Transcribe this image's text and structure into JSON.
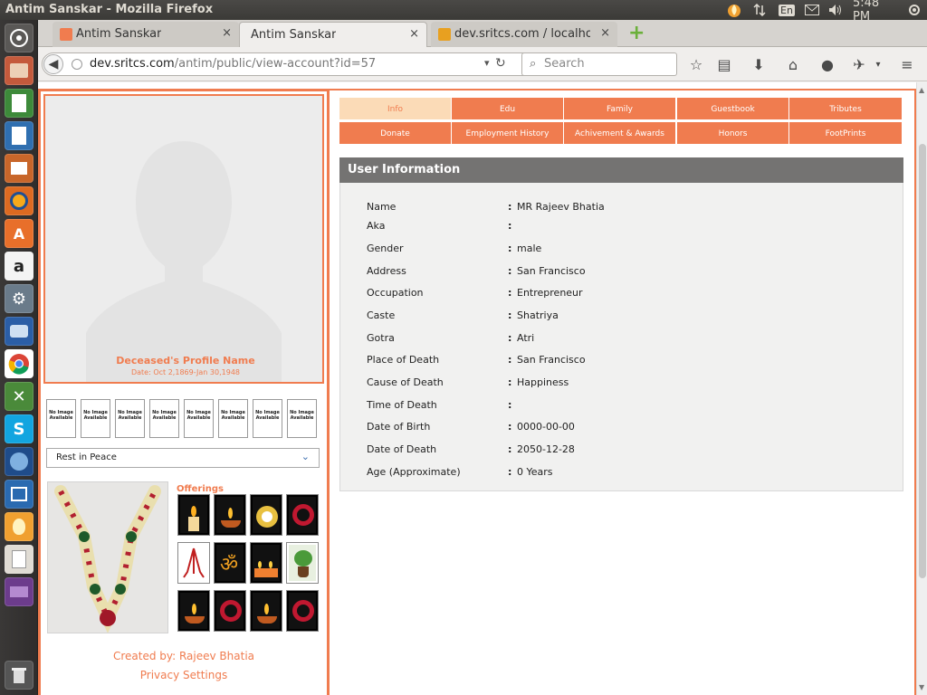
{
  "system": {
    "window_title": "Antim Sanskar - Mozilla Firefox",
    "keyboard_layout": "En",
    "clock": "5:48 PM"
  },
  "browser": {
    "tabs": [
      {
        "label": "Antim Sanskar",
        "close": "×",
        "active": false
      },
      {
        "label": "Antim Sanskar",
        "close": "×",
        "active": true
      },
      {
        "label": "dev.sritcs.com / localho…",
        "close": "×",
        "active": false
      }
    ],
    "new_tab": "+",
    "url_domain": "dev.sritcs.com",
    "url_path": "/antim/public/view-account?id=57",
    "search_placeholder": "Search"
  },
  "profile": {
    "name": "Deceased's Profile Name",
    "dates": "Date: Oct 2,1869-Jan 30,1948",
    "thumb_text": "No Image Available",
    "dropdown_value": "Rest in Peace",
    "offerings_title": "Offerings",
    "created_by": "Created by: Rajeev Bhatia",
    "privacy": "Privacy Settings"
  },
  "tabs_row1": [
    "Info",
    "Edu",
    "Family",
    "Guestbook",
    "Tributes"
  ],
  "tabs_row2": [
    "Donate",
    "Employment History",
    "Achivement & Awards",
    "Honors",
    "FootPrints"
  ],
  "info": {
    "title": "User Information",
    "rows": [
      {
        "label": "Name",
        "value": "MR Rajeev Bhatia"
      },
      {
        "label": "Aka",
        "value": ""
      },
      {
        "label": "Gender",
        "value": "male"
      },
      {
        "label": "Address",
        "value": "San Francisco"
      },
      {
        "label": "Occupation",
        "value": "Entrepreneur"
      },
      {
        "label": "Caste",
        "value": "Shatriya"
      },
      {
        "label": "Gotra",
        "value": "Atri"
      },
      {
        "label": "Place of Death",
        "value": "San Francisco"
      },
      {
        "label": "Cause of Death",
        "value": "Happiness"
      },
      {
        "label": "Time of Death",
        "value": ""
      },
      {
        "label": "Date of Birth",
        "value": "0000-00-00"
      },
      {
        "label": "Date of Death",
        "value": "2050-12-28"
      },
      {
        "label": "Age (Approximate)",
        "value": "0 Years"
      }
    ]
  },
  "colors": {
    "accent": "#f07c4f",
    "active_tab": "#fbdbb7",
    "header": "#747372"
  }
}
